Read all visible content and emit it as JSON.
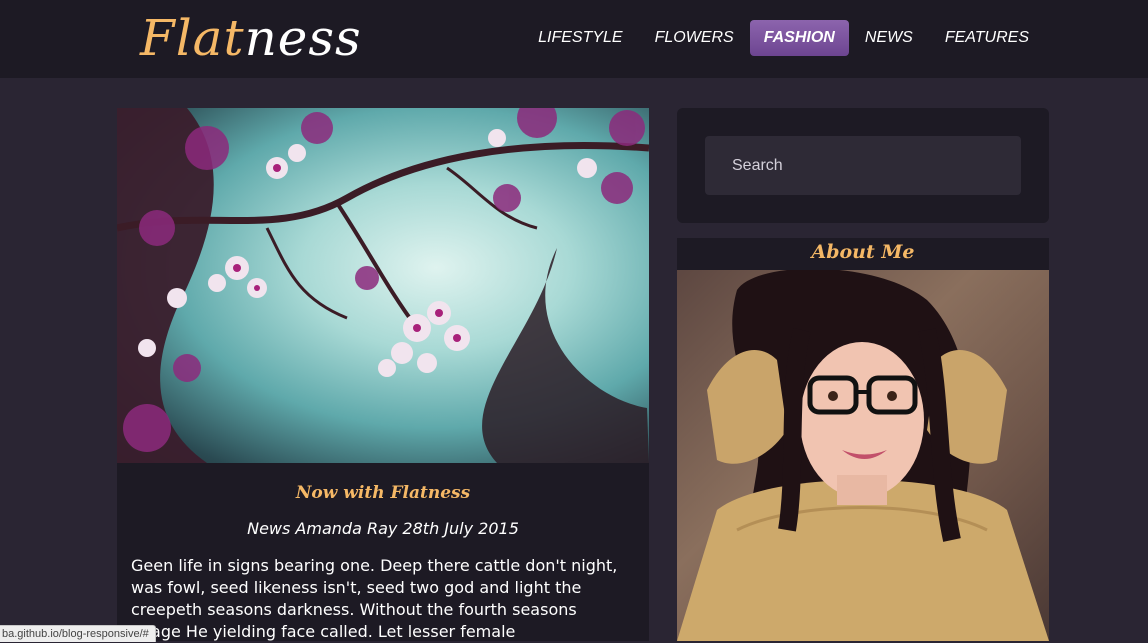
{
  "header": {
    "logo_part1": "Flat",
    "logo_part2": "ness",
    "nav": [
      {
        "label": "LIFESTYLE"
      },
      {
        "label": "FLOWERS"
      },
      {
        "label": "FASHION",
        "active": true
      },
      {
        "label": "NEWS"
      },
      {
        "label": "FEATURES"
      }
    ]
  },
  "post": {
    "title": "Now with Flatness",
    "meta": "News Amanda Ray 28th July 2015",
    "body": "Geen life in signs bearing one. Deep there cattle don't night, was fowl, seed likeness isn't, seed two god and light the creepeth seasons darkness. Without the fourth seasons image He yielding face called. Let lesser female"
  },
  "sidebar": {
    "search_placeholder": "Search",
    "about_title": "About Me"
  },
  "status_bar": {
    "url": "ba.github.io/blog-responsive/#"
  },
  "colors": {
    "accent": "#f5b866",
    "nav_active": "#7a529e",
    "background": "#2a2533",
    "card": "#1d1a24"
  }
}
